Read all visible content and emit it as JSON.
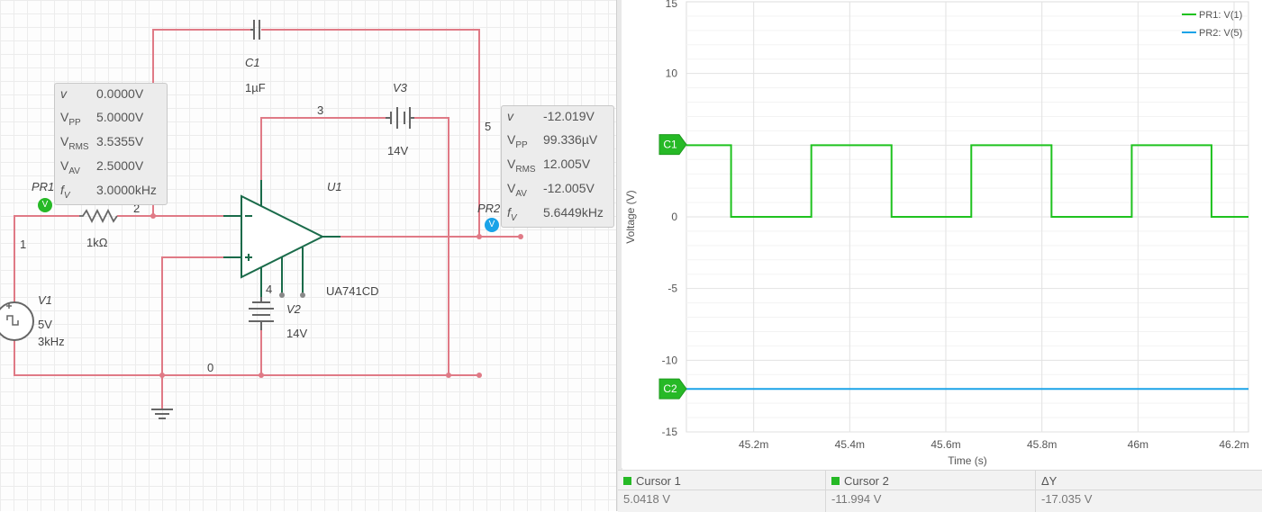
{
  "schematic": {
    "c1": {
      "name": "C1",
      "value": "1µF"
    },
    "v3": {
      "name": "V3",
      "value": "14V"
    },
    "u1": {
      "name": "U1",
      "model": "UA741CD"
    },
    "v2": {
      "name": "V2",
      "value": "14V"
    },
    "v1": {
      "name": "V1",
      "amplitude": "5V",
      "freq": "3kHz"
    },
    "r1": {
      "value": "1kΩ"
    },
    "nodes": {
      "n0": "0",
      "n1": "1",
      "n2": "2",
      "n3": "3",
      "n4": "4",
      "n5": "5"
    },
    "pr1": {
      "name": "PR1",
      "badge": "V",
      "v": "0.0000V",
      "vpp": "5.0000V",
      "vrms": "3.5355V",
      "vav": "2.5000V",
      "fv": "3.0000kHz"
    },
    "pr2": {
      "name": "PR2",
      "badge": "V",
      "v": "-12.019V",
      "vpp": "99.336µV",
      "vrms": "12.005V",
      "vav": "-12.005V",
      "fv": "5.6449kHz"
    }
  },
  "plot": {
    "ylabel": "Voltage (V)",
    "xlabel": "Time (s)",
    "y_ticks": [
      "10",
      "5",
      "0",
      "-5",
      "-10",
      "-15"
    ],
    "x_ticks": [
      "45.2m",
      "45.4m",
      "45.6m",
      "45.8m",
      "46m",
      "46.2m"
    ],
    "top_tick_partial": "15",
    "legend": [
      "PR1: V(1)",
      "PR2: V(5)"
    ],
    "cursor_markers": [
      "C1",
      "C2"
    ]
  },
  "chart_data": {
    "type": "line",
    "xlabel": "Time (s)",
    "ylabel": "Voltage (V)",
    "ylim": [
      -15,
      15
    ],
    "xlim": [
      0.04506,
      0.04623
    ],
    "grid": true,
    "legend_position": "top-right",
    "series": [
      {
        "name": "PR1: V(1)",
        "color": "#1fc21f",
        "x": [
          0.04506,
          0.045153,
          0.045153,
          0.04532,
          0.04532,
          0.045487,
          0.045487,
          0.045653,
          0.045653,
          0.04582,
          0.04582,
          0.045987,
          0.045987,
          0.046153,
          0.046153,
          0.04623
        ],
        "y": [
          5,
          5,
          0,
          0,
          5,
          5,
          0,
          0,
          5,
          5,
          0,
          0,
          5,
          5,
          0,
          0
        ]
      },
      {
        "name": "PR2: V(5)",
        "color": "#1aa3e8",
        "x": [
          0.04506,
          0.04623
        ],
        "y": [
          -12.0,
          -12.0
        ]
      }
    ],
    "cursor_y": {
      "C1": 5.0418,
      "C2": -11.994
    }
  },
  "cursors": {
    "c1_label": "Cursor 1",
    "c1_value": "5.0418 V",
    "c2_label": "Cursor 2",
    "c2_value": "-11.994 V",
    "dy_label": "ΔY",
    "dy_value": "-17.035 V"
  },
  "colors": {
    "wire": "#e07a86",
    "trace_green": "#1fc21f",
    "trace_blue": "#1aa3e8",
    "opamp": "#1a6b4a"
  }
}
